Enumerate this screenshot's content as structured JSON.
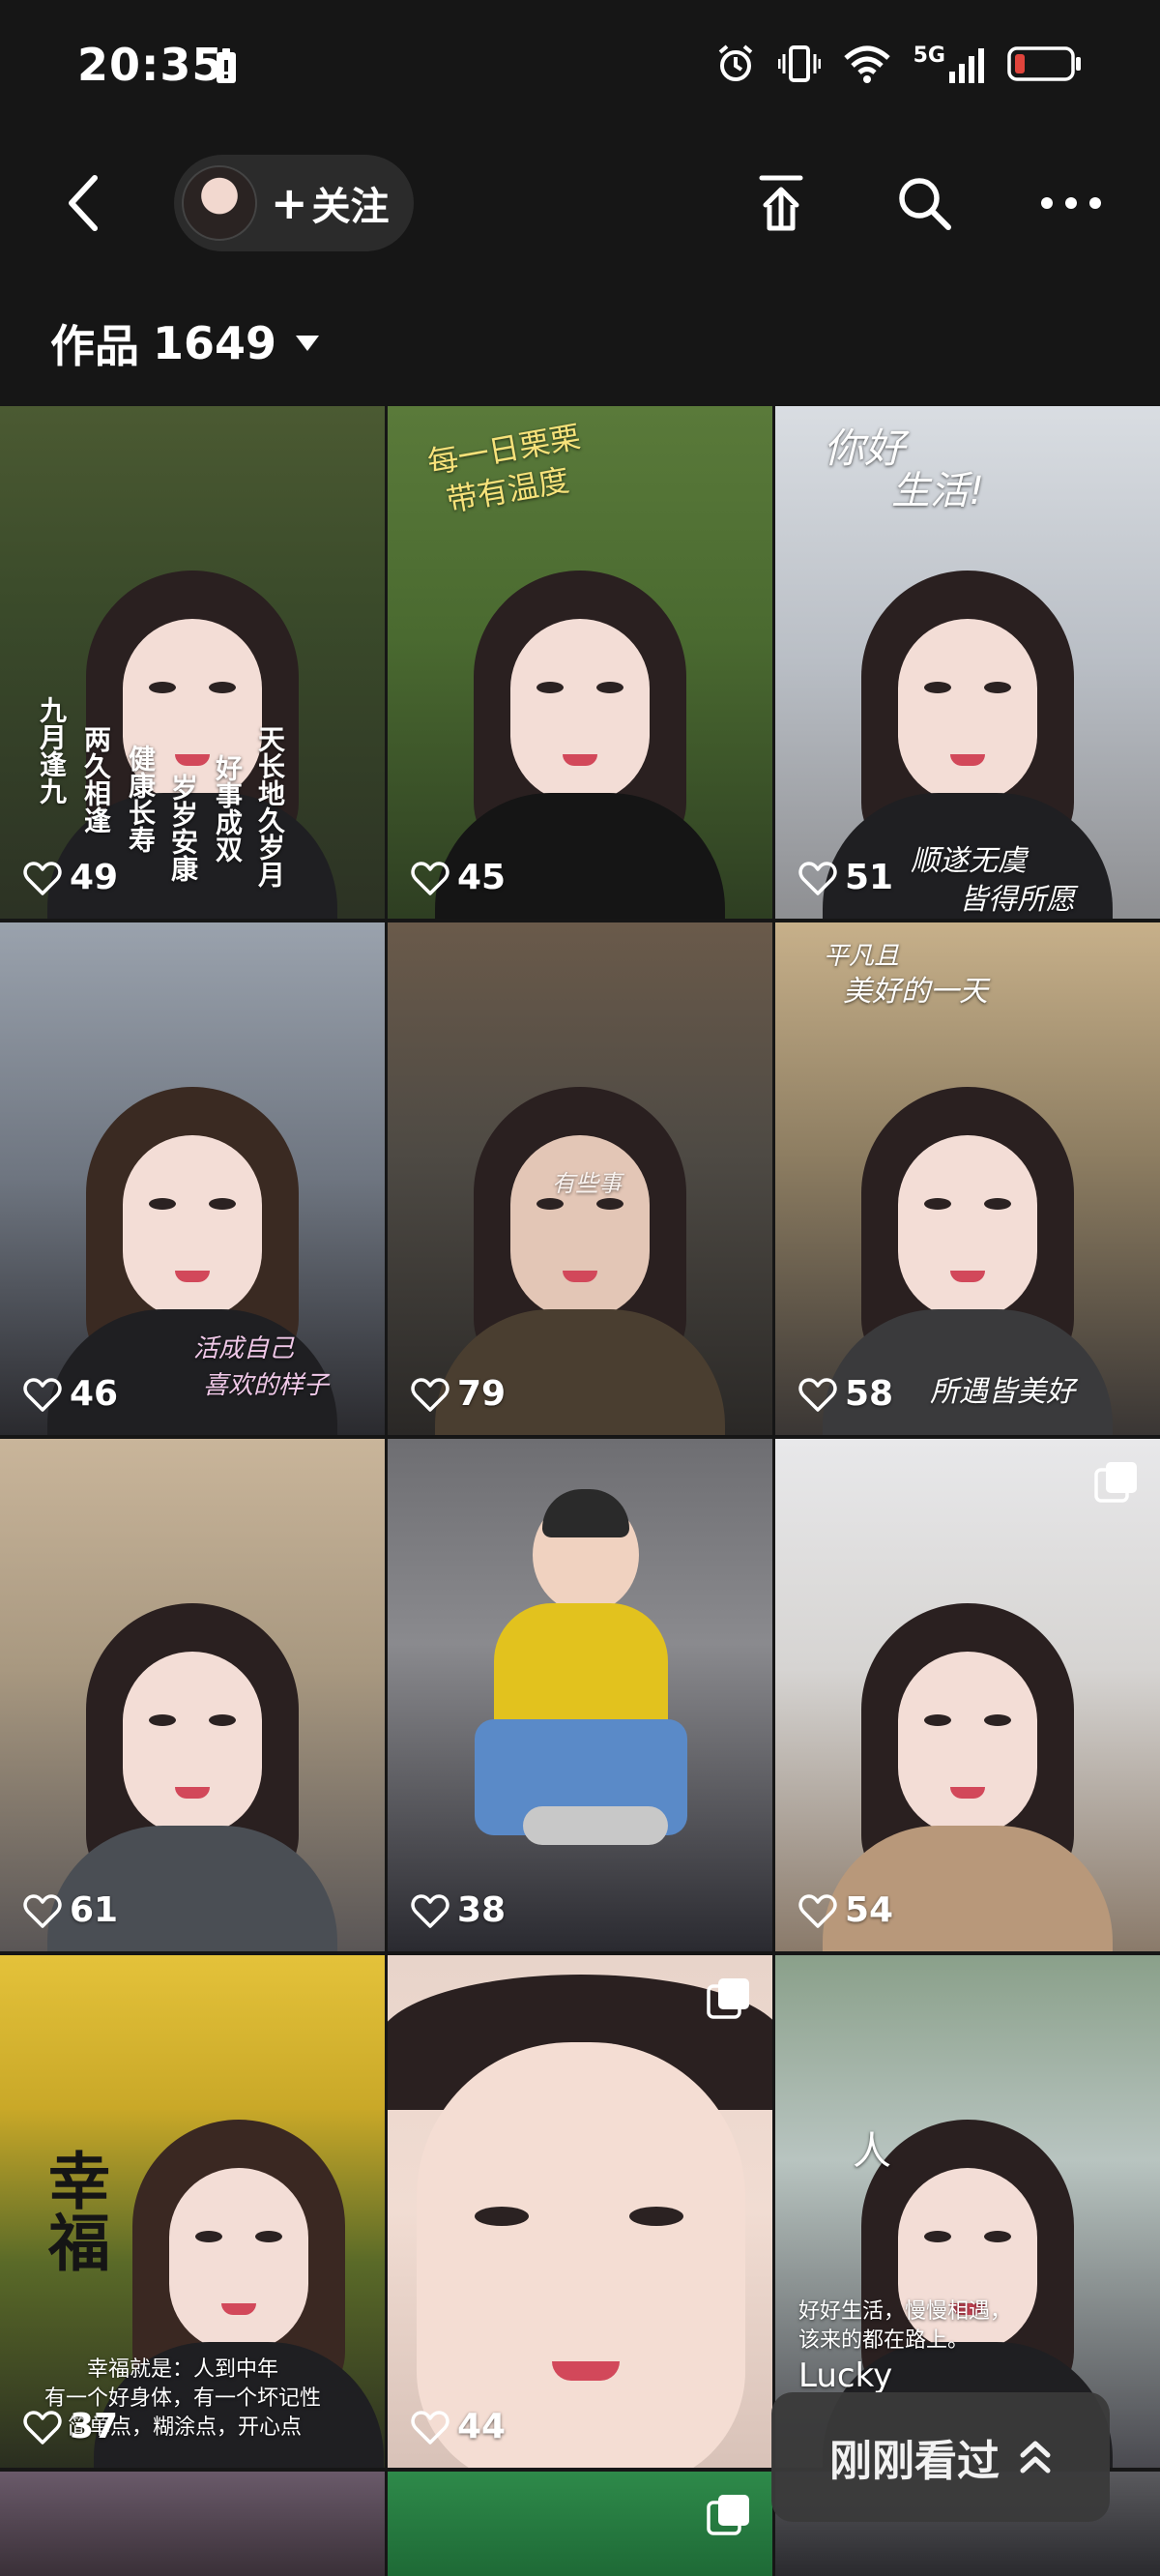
{
  "status_bar": {
    "time": "20:35",
    "network": "5G",
    "icons": [
      "battery-saver-icon",
      "alarm-icon",
      "vibrate-icon",
      "wifi-icon",
      "signal-icon",
      "battery-low-icon"
    ]
  },
  "nav": {
    "follow_label": "关注",
    "icons": [
      "back-icon",
      "share-icon",
      "search-icon",
      "more-icon"
    ]
  },
  "works": {
    "label": "作品",
    "count": "1649"
  },
  "tiles": [
    {
      "likes": "49",
      "overlay": [
        "九月逢九",
        "两久相逢",
        "健康长寿",
        "岁岁安康",
        "好事成双",
        "天长地久岁月"
      ]
    },
    {
      "likes": "45",
      "overlay": [
        "每一日栗栗",
        "带有温度"
      ]
    },
    {
      "likes": "51",
      "overlay": [
        "你好",
        "生活!",
        "顺遂无虞",
        "皆得所愿"
      ]
    },
    {
      "likes": "46",
      "overlay": [
        "活成自己",
        "喜欢的样子"
      ]
    },
    {
      "likes": "79",
      "overlay": [
        "有些事"
      ]
    },
    {
      "likes": "58",
      "overlay": [
        "平凡且",
        "美好的一天",
        "所遇皆美好"
      ]
    },
    {
      "likes": "61",
      "overlay": []
    },
    {
      "likes": "38",
      "overlay": []
    },
    {
      "likes": "54",
      "overlay": []
    },
    {
      "likes": "37",
      "overlay": [
        "幸福",
        "幸福就是：人到中年",
        "有一个好身体，有一个坏记性",
        "简单点，糊涂点，开心点"
      ]
    },
    {
      "likes": "44",
      "overlay": []
    },
    {
      "likes": "",
      "overlay": [
        "人",
        "好好生活，慢慢相遇，",
        "该来的都在路上。",
        "Lucky"
      ]
    }
  ],
  "recent": {
    "label": "刚刚看过"
  },
  "colors": {
    "background": "#161616",
    "text": "#ffffff",
    "pill": "#2b2b2b",
    "battery_low": "#e0443c"
  }
}
